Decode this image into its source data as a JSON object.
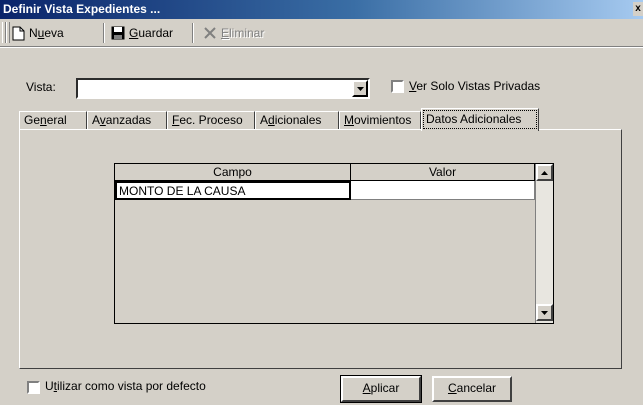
{
  "window": {
    "title": "Definir Vista Expedientes ...",
    "close_glyph": "x"
  },
  "toolbar": {
    "nueva": {
      "pre": "N",
      "acc": "u",
      "post": "eva",
      "icon": "new-document-icon"
    },
    "guardar": {
      "pre": "",
      "acc": "G",
      "post": "uardar",
      "icon": "floppy-disk-icon"
    },
    "eliminar": {
      "pre": "",
      "acc": "E",
      "post": "liminar",
      "icon": "delete-x-icon"
    }
  },
  "vista": {
    "label": "Vista:",
    "value": ""
  },
  "solo_privadas": {
    "pre": "",
    "acc": "V",
    "post": "er Solo Vistas Privadas",
    "checked": false
  },
  "tabs": [
    {
      "pre": "Ge",
      "acc": "n",
      "post": "eral"
    },
    {
      "pre": "A",
      "acc": "v",
      "post": "anzadas"
    },
    {
      "pre": "",
      "acc": "F",
      "post": "ec. Proceso"
    },
    {
      "pre": "A",
      "acc": "d",
      "post": "icionales"
    },
    {
      "pre": "",
      "acc": "M",
      "post": "ovimientos"
    },
    {
      "pre": "Datos Adicionales",
      "acc": "",
      "post": "",
      "active": true
    }
  ],
  "grid": {
    "columns": [
      "Campo",
      "Valor"
    ],
    "rows": [
      {
        "campo": "MONTO DE LA CAUSA",
        "valor": ""
      }
    ]
  },
  "default_view": {
    "pre": "U",
    "acc": "t",
    "post": "ilizar como vista por defecto",
    "checked": false
  },
  "buttons": {
    "aplicar": {
      "pre": "",
      "acc": "A",
      "post": "plicar"
    },
    "cancelar": {
      "pre": "",
      "acc": "C",
      "post": "ancelar"
    }
  },
  "colors": {
    "title_start": "#0a246a",
    "title_end": "#a6caf0",
    "face": "#d4d0c8"
  }
}
